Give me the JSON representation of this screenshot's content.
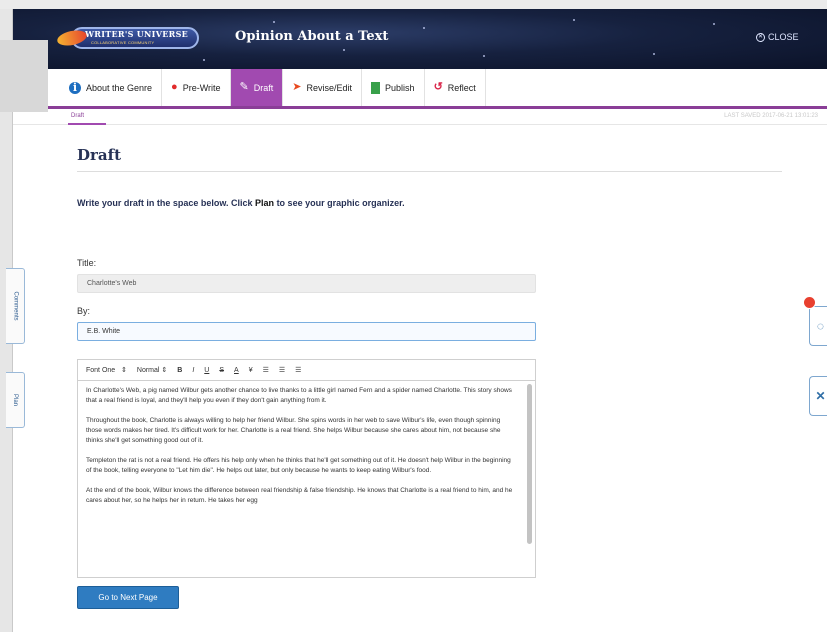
{
  "header": {
    "logo_text": "WRITER'S UNIVERSE",
    "logo_subtext": "COLLABORATIVE COMMUNITY",
    "title": "Opinion About a Text",
    "close_label": "CLOSE"
  },
  "tabs": [
    {
      "label": "About the Genre",
      "icon": "info-icon",
      "active": false
    },
    {
      "label": "Pre-Write",
      "icon": "pin-icon",
      "active": false
    },
    {
      "label": "Draft",
      "icon": "pencil-icon",
      "active": true
    },
    {
      "label": "Revise/Edit",
      "icon": "cursor-icon",
      "active": false
    },
    {
      "label": "Publish",
      "icon": "document-icon",
      "active": false
    },
    {
      "label": "Reflect",
      "icon": "reflect-icon",
      "active": false
    }
  ],
  "breadcrumb": "Draft",
  "last_saved": "LAST SAVED 2017-06-21 13:01:23",
  "page": {
    "title": "Draft",
    "instructions_pre": "Write your draft in the space below. Click ",
    "instructions_link": "Plan",
    "instructions_post": " to see your graphic organizer."
  },
  "form": {
    "title_label": "Title:",
    "title_value": "Charlotte's Web",
    "by_label": "By:",
    "by_value": "E.B. White"
  },
  "toolbar": {
    "font": "Font One",
    "size": "Normal",
    "buttons": [
      "B",
      "I",
      "U",
      "S",
      "A",
      "¥",
      "☰",
      "☰",
      "☰"
    ]
  },
  "editor": {
    "paragraphs": [
      "In Charlotte's Web, a pig named Wilbur gets another chance to live thanks to a little girl named Fern and a spider named Charlotte. This story shows that a real friend is loyal, and they'll help you even if they don't gain anything from it.",
      "Throughout the book, Charlotte is always willing to help her friend Wilbur. She spins words in her web to save Wilbur's life, even though spinning those words makes her tired. It's difficult work for her. Charlotte is a real friend. She helps Wilbur because she cares about him, not because she thinks she'll get something good out of it.",
      "Templeton the rat is not a real friend. He offers his help only when he thinks that he'll get something out of it. He doesn't help Wilbur in the beginning of the book, telling everyone to \"Let him die\". He helps out later, but only because he wants to keep eating Wilbur's food.",
      "At the end of the book, Wilbur knows the difference between real friendship & false friendship. He knows that Charlotte is a real friend to him, and he cares about her, so he helps her in return. He takes her egg"
    ]
  },
  "next_button": "Go to Next Page",
  "side_tabs": {
    "comments": "Comments",
    "plan": "Plan"
  },
  "colors": {
    "accent_purple": "#a14ab0",
    "header_navy": "#16213f",
    "button_blue": "#2f7cc1",
    "notification_red": "#e8402f"
  }
}
